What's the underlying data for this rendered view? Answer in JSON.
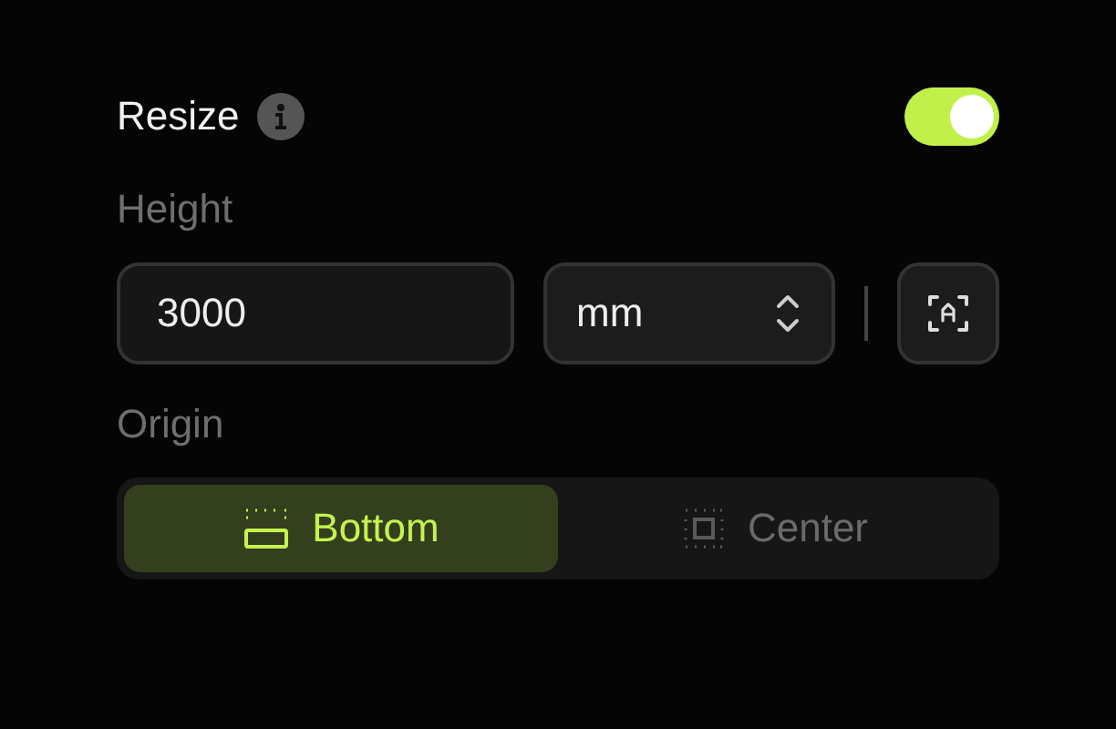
{
  "resize": {
    "title": "Resize",
    "on": true
  },
  "height": {
    "label": "Height",
    "value": "3000",
    "unit": "mm"
  },
  "origin": {
    "label": "Origin",
    "options": [
      {
        "label": "Bottom",
        "kind": "bottom",
        "selected": true
      },
      {
        "label": "Center",
        "kind": "center",
        "selected": false
      }
    ]
  }
}
